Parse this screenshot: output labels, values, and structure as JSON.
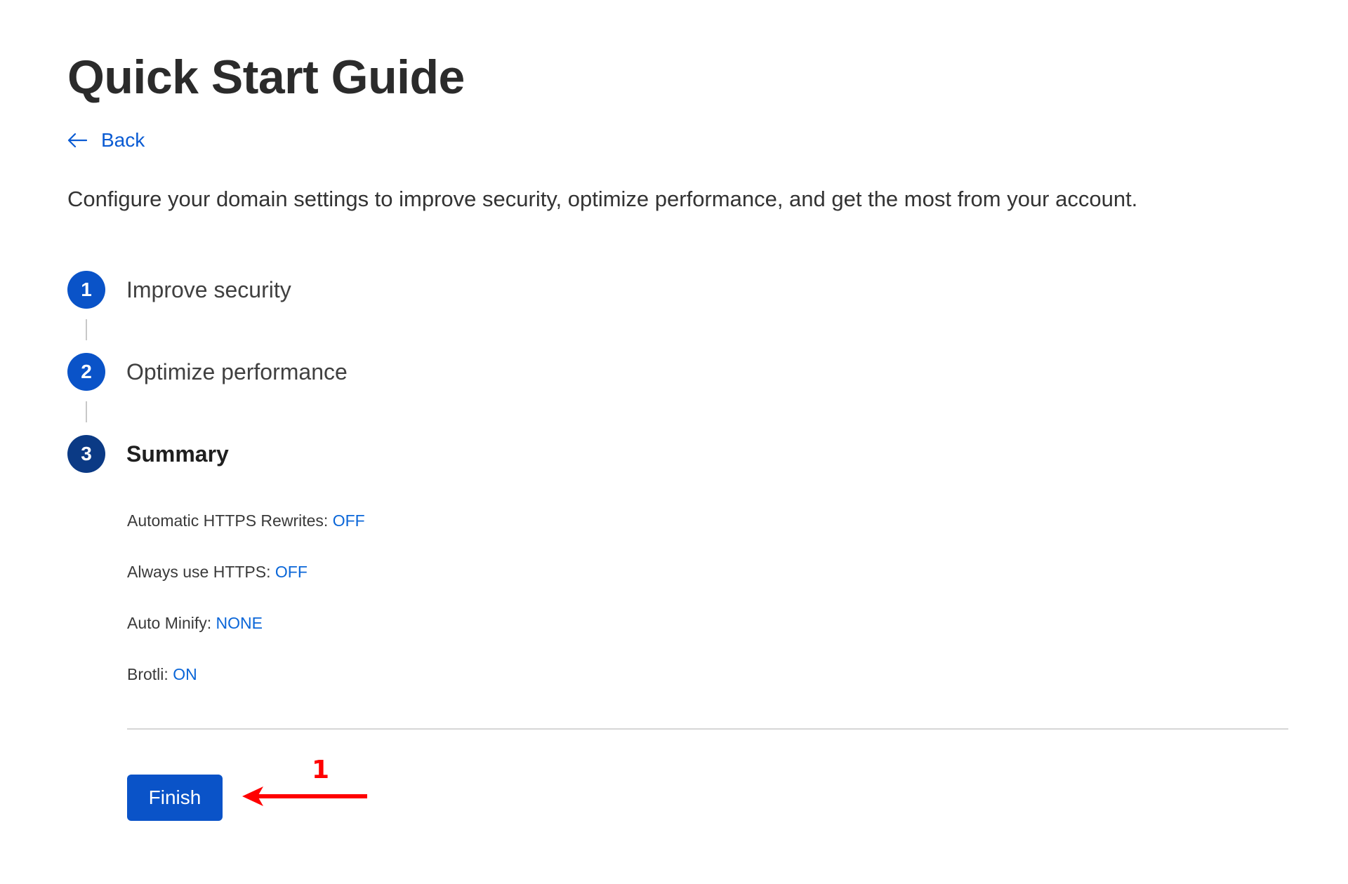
{
  "page": {
    "title": "Quick Start Guide",
    "back_label": "Back",
    "intro": "Configure your domain settings to improve security, optimize performance, and get the most from your account."
  },
  "steps": [
    {
      "number": "1",
      "label": "Improve security",
      "state": "completed"
    },
    {
      "number": "2",
      "label": "Optimize performance",
      "state": "completed"
    },
    {
      "number": "3",
      "label": "Summary",
      "state": "current"
    }
  ],
  "summary": [
    {
      "label": "Automatic HTTPS Rewrites: ",
      "value": "OFF"
    },
    {
      "label": "Always use HTTPS: ",
      "value": "OFF"
    },
    {
      "label": "Auto Minify: ",
      "value": "NONE"
    },
    {
      "label": "Brotli: ",
      "value": "ON"
    }
  ],
  "actions": {
    "finish_label": "Finish"
  },
  "annotation": {
    "number": "1"
  },
  "icons": {
    "back": "arrow-left-icon"
  },
  "colors": {
    "accent": "#0a53c8",
    "link": "#0a66d8",
    "current_step": "#0b3a85",
    "annotation": "#ff0000"
  }
}
